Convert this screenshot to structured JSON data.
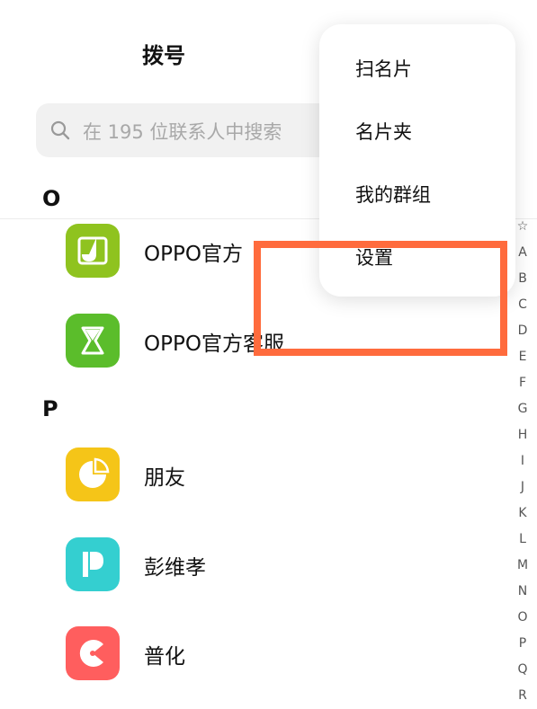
{
  "header": {
    "title": "拨号"
  },
  "search": {
    "placeholder": "在 195 位联系人中搜索"
  },
  "sections": [
    {
      "letter": "O",
      "contacts": [
        {
          "name": "OPPO官方",
          "color": "#8fc31f"
        },
        {
          "name": "OPPO官方客服",
          "color": "#5bbd2b"
        }
      ]
    },
    {
      "letter": "P",
      "contacts": [
        {
          "name": "朋友",
          "color": "#f5c518"
        },
        {
          "name": "彭维孝",
          "color": "#34cfd0"
        },
        {
          "name": "普化",
          "color": "#ff5e5e"
        }
      ]
    }
  ],
  "menu": {
    "items": [
      "扫名片",
      "名片夹",
      "我的群组",
      "设置"
    ]
  },
  "index": [
    "☆",
    "A",
    "B",
    "C",
    "D",
    "E",
    "F",
    "G",
    "H",
    "I",
    "J",
    "K",
    "L",
    "M",
    "N",
    "O",
    "P",
    "Q",
    "R"
  ],
  "colors": {
    "highlight": "#ff6b3d",
    "search_bg": "#f1f1f1"
  }
}
